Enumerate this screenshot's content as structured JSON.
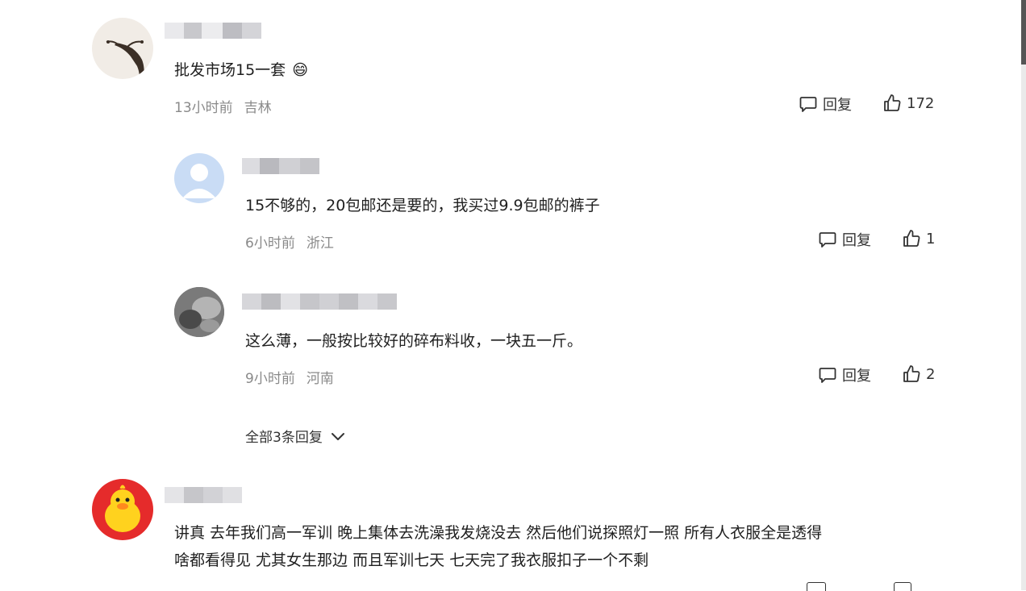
{
  "comments": [
    {
      "text": "批发市场15一套",
      "emoji": "😄",
      "time": "13小时前",
      "location": "吉林",
      "reply_label": "回复",
      "likes": "172"
    },
    {
      "text": "15不够的，20包邮还是要的，我买过9.9包邮的裤子",
      "time": "6小时前",
      "location": "浙江",
      "reply_label": "回复",
      "likes": "1"
    },
    {
      "text": "这么薄，一般按比较好的碎布料收，一块五一斤。",
      "time": "9小时前",
      "location": "河南",
      "reply_label": "回复",
      "likes": "2"
    },
    {
      "text_line1": "讲真 去年我们高一军训 晚上集体去洗澡我发烧没去 然后他们说探照灯一照 所有人衣服全是透得",
      "text_line2": "啥都看得见 尤其女生那边 而且军训七天 七天完了我衣服扣子一个不剩"
    }
  ],
  "expand_replies": "全部3条回复",
  "icons": {
    "reply": "comment-bubble-icon",
    "like": "thumbs-up-icon",
    "expand": "chevron-down-icon"
  },
  "colors": {
    "meta_text": "#8a8a8a",
    "content_text": "#1f1f1f"
  }
}
